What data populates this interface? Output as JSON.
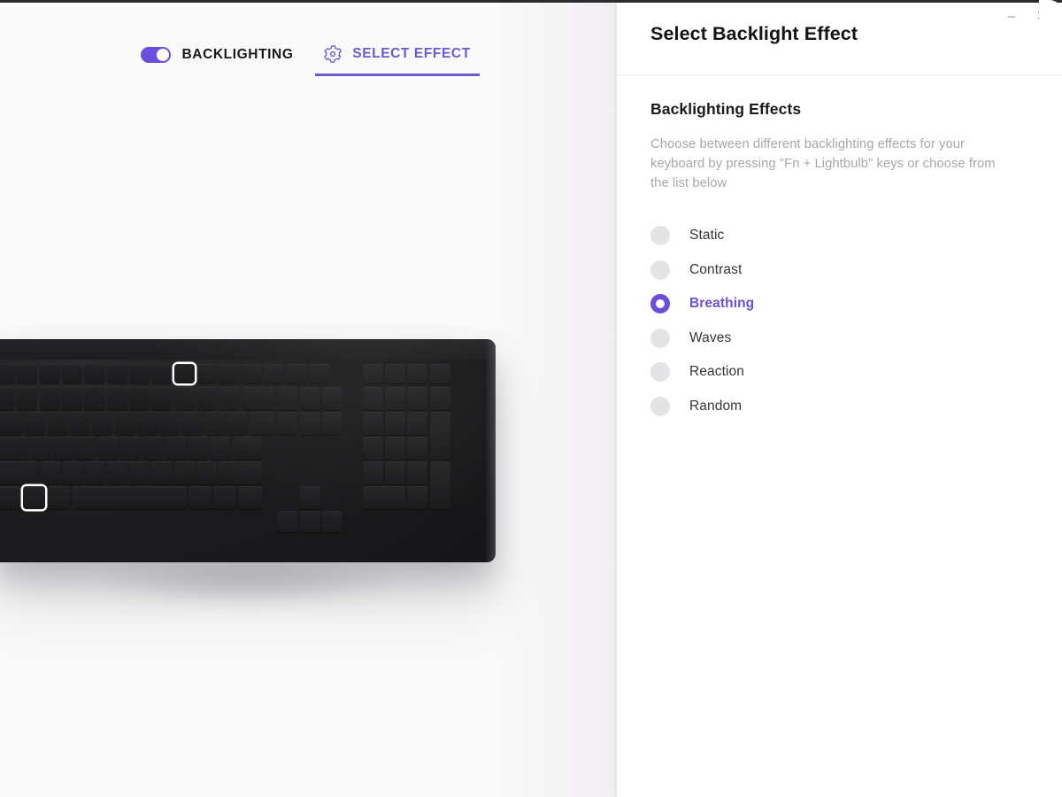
{
  "window": {
    "controls": [
      {
        "name": "minimize",
        "glyph": "–"
      },
      {
        "name": "close",
        "glyph": "✕"
      }
    ]
  },
  "left_panel": {
    "toolbar": {
      "backlighting": {
        "label": "BACKLIGHTING",
        "toggle_state": "on"
      },
      "select_effect": {
        "label": "SELECT EFFECT",
        "icon": "gear-icon",
        "active": true
      }
    },
    "device_image": {
      "alt": "keyboard",
      "highlighted_keys": [
        "Fn",
        "Lightbulb"
      ]
    }
  },
  "right_panel": {
    "title": "Select Backlight Effect",
    "section_heading": "Backlighting Effects",
    "section_description": "Choose between different backlighting effects for your keyboard by pressing \"Fn + Lightbulb\" keys or choose from the list below",
    "effects": [
      {
        "label": "Static",
        "selected": false
      },
      {
        "label": "Contrast",
        "selected": false
      },
      {
        "label": "Breathing",
        "selected": true
      },
      {
        "label": "Waves",
        "selected": false
      },
      {
        "label": "Reaction",
        "selected": false
      },
      {
        "label": "Random",
        "selected": false
      }
    ]
  },
  "colors": {
    "accent_purple": "#6b4ede",
    "tab_underline": "#6b5ad0",
    "radio_idle": "#e4e3e5",
    "muted_text": "#a9a6ad",
    "panel_background": "#fafafa",
    "divider": "#f5eef0"
  }
}
